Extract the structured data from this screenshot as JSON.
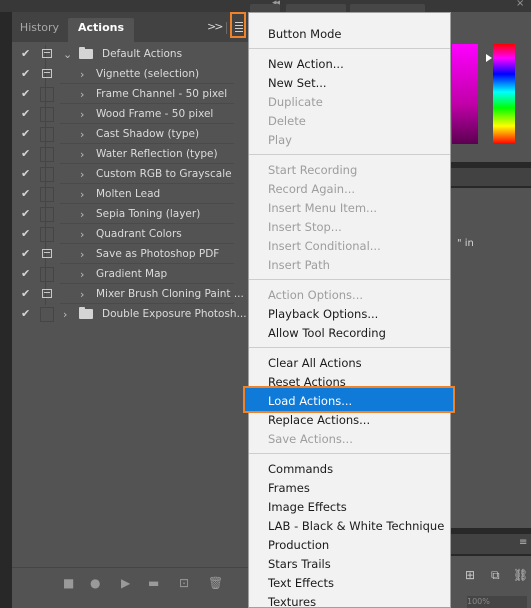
{
  "panel": {
    "tabs": [
      {
        "label": "History"
      },
      {
        "label": "Actions"
      }
    ],
    "collapse_label": ">>"
  },
  "actions": [
    {
      "name": "Default Actions",
      "type": "set",
      "expanded": true,
      "checked": true,
      "dialog": true
    },
    {
      "name": "Vignette (selection)",
      "type": "action",
      "checked": true,
      "dialog": true
    },
    {
      "name": "Frame Channel - 50 pixel",
      "type": "action",
      "checked": true,
      "dialog": false
    },
    {
      "name": "Wood Frame - 50 pixel",
      "type": "action",
      "checked": true,
      "dialog": false
    },
    {
      "name": "Cast Shadow (type)",
      "type": "action",
      "checked": true,
      "dialog": false
    },
    {
      "name": "Water Reflection (type)",
      "type": "action",
      "checked": true,
      "dialog": false
    },
    {
      "name": "Custom RGB to Grayscale",
      "type": "action",
      "checked": true,
      "dialog": false
    },
    {
      "name": "Molten Lead",
      "type": "action",
      "checked": true,
      "dialog": false
    },
    {
      "name": "Sepia Toning (layer)",
      "type": "action",
      "checked": true,
      "dialog": false
    },
    {
      "name": "Quadrant Colors",
      "type": "action",
      "checked": true,
      "dialog": false
    },
    {
      "name": "Save as Photoshop PDF",
      "type": "action",
      "checked": true,
      "dialog": true
    },
    {
      "name": "Gradient Map",
      "type": "action",
      "checked": true,
      "dialog": false
    },
    {
      "name": "Mixer Brush Cloning Paint ...",
      "type": "action",
      "checked": true,
      "dialog": true
    },
    {
      "name": "Double Exposure Photosh...",
      "type": "set",
      "expanded": false,
      "checked": true,
      "dialog": false
    }
  ],
  "menu": {
    "items": [
      {
        "label": "Button Mode",
        "enabled": true
      },
      {
        "label": "New Action...",
        "enabled": true
      },
      {
        "label": "New Set...",
        "enabled": true
      },
      {
        "label": "Duplicate",
        "enabled": false
      },
      {
        "label": "Delete",
        "enabled": false
      },
      {
        "label": "Play",
        "enabled": false
      },
      {
        "label": "Start Recording",
        "enabled": false
      },
      {
        "label": "Record Again...",
        "enabled": false
      },
      {
        "label": "Insert Menu Item...",
        "enabled": false
      },
      {
        "label": "Insert Stop...",
        "enabled": false
      },
      {
        "label": "Insert Conditional...",
        "enabled": false
      },
      {
        "label": "Insert Path",
        "enabled": false
      },
      {
        "label": "Action Options...",
        "enabled": false
      },
      {
        "label": "Playback Options...",
        "enabled": true
      },
      {
        "label": "Allow Tool Recording",
        "enabled": true
      },
      {
        "label": "Clear All Actions",
        "enabled": true
      },
      {
        "label": "Reset Actions",
        "enabled": true
      },
      {
        "label": "Load Actions...",
        "enabled": true,
        "highlighted": true
      },
      {
        "label": "Replace Actions...",
        "enabled": true
      },
      {
        "label": "Save Actions...",
        "enabled": false
      },
      {
        "label": "Commands",
        "enabled": true
      },
      {
        "label": "Frames",
        "enabled": true
      },
      {
        "label": "Image Effects",
        "enabled": true
      },
      {
        "label": "LAB - Black & White Technique",
        "enabled": true
      },
      {
        "label": "Production",
        "enabled": true
      },
      {
        "label": "Stars Trails",
        "enabled": true
      },
      {
        "label": "Text Effects",
        "enabled": true
      },
      {
        "label": "Textures",
        "enabled": true
      }
    ]
  },
  "background_panel": {
    "partial_text": "\" in",
    "zoom": "100%"
  },
  "icons": {
    "panel_menu": "panel-menu-icon",
    "stop": "stop-icon",
    "record": "record-icon",
    "play": "play-icon",
    "new_set": "folder-icon",
    "new_action": "new-action-icon",
    "delete": "trash-icon"
  },
  "colors": {
    "highlight": "#0f7ad8",
    "callout": "#f0822a"
  }
}
